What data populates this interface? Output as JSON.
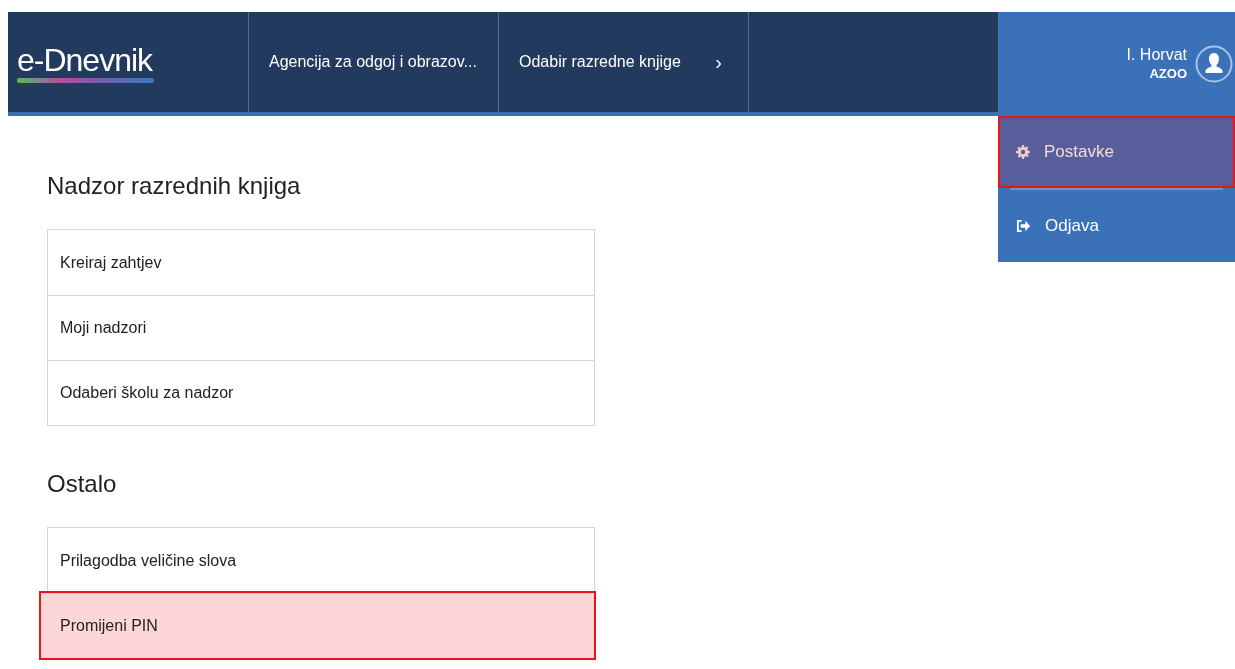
{
  "nav": {
    "brand": "e-Dnevnik",
    "items": [
      {
        "label": "Agencija za odgoj i obrazov..."
      },
      {
        "label": "Odabir razredne knjige",
        "chevron_text": "›"
      }
    ]
  },
  "user": {
    "name": "I. Horvat",
    "org": "AZOO"
  },
  "user_menu": [
    {
      "label": "Postavke",
      "kind": "settings",
      "highlighted": true
    },
    {
      "label": "Odjava",
      "kind": "logout",
      "highlighted": false
    }
  ],
  "sections": [
    {
      "title": "Nadzor razrednih knjiga",
      "items": [
        {
          "label": "Kreiraj zahtjev",
          "highlighted": false
        },
        {
          "label": "Moji nadzori",
          "highlighted": false
        },
        {
          "label": "Odaberi školu za nadzor",
          "highlighted": false
        }
      ]
    },
    {
      "title": "Ostalo",
      "items": [
        {
          "label": "Prilagodba veličine slova",
          "highlighted": false
        },
        {
          "label": "Promijeni PIN",
          "highlighted": true
        }
      ]
    }
  ]
}
